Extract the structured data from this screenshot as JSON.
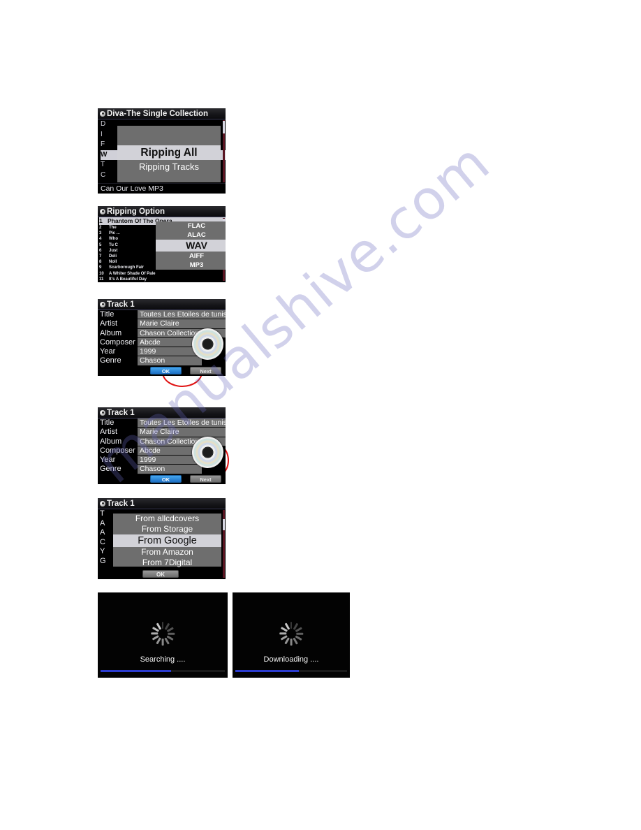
{
  "watermark": {
    "text": "manualshive.com"
  },
  "panel1": {
    "title": "Diva-The Single Collection",
    "background_rows": [
      "D",
      "I",
      "F",
      "W",
      "T",
      "C"
    ],
    "footer": "Can Our Love MP3",
    "menu": [
      {
        "label": "Ripping All",
        "selected": true
      },
      {
        "label": "Ripping Tracks",
        "selected": false
      }
    ]
  },
  "panel2": {
    "title": "Ripping Option",
    "tracks": [
      {
        "num": "1",
        "name": "Phantom Of The Opera",
        "selected": true
      },
      {
        "num": "2",
        "name": "The",
        "selected": false
      },
      {
        "num": "3",
        "name": "Pic ...",
        "selected": false
      },
      {
        "num": "4",
        "name": "Who",
        "selected": false
      },
      {
        "num": "5",
        "name": "Tu C",
        "selected": false
      },
      {
        "num": "6",
        "name": "Just",
        "selected": false
      },
      {
        "num": "7",
        "name": "Deli",
        "selected": false
      },
      {
        "num": "8",
        "name": "Noll",
        "selected": false
      },
      {
        "num": "9",
        "name": "Scarborough Fair",
        "selected": false
      },
      {
        "num": "10",
        "name": "A Whiter Shade Of Pale",
        "selected": false
      },
      {
        "num": "11",
        "name": "It's A Beautiful Day",
        "selected": false
      }
    ],
    "formats": [
      {
        "label": "FLAC",
        "selected": false
      },
      {
        "label": "ALAC",
        "selected": false
      },
      {
        "label": "WAV",
        "selected": true
      },
      {
        "label": "AIFF",
        "selected": false
      },
      {
        "label": "MP3",
        "selected": false
      }
    ]
  },
  "panel3": {
    "title": "Track 1",
    "fields": [
      {
        "label": "Title",
        "value": "Toutes Les Etoiles de tunisie"
      },
      {
        "label": "Artist",
        "value": "Marie Claire"
      },
      {
        "label": "Album",
        "value": "Chason Collection"
      },
      {
        "label": "Composer",
        "value": "Abcde"
      },
      {
        "label": "Year",
        "value": "1999"
      },
      {
        "label": "Genre",
        "value": "Chason"
      }
    ],
    "buttons": {
      "ok": "OK",
      "next": "Next"
    },
    "highlighted": "next-button"
  },
  "panel4": {
    "title": "Track 1",
    "fields": [
      {
        "label": "Title",
        "value": "Toutes Les Etoiles de tunisie"
      },
      {
        "label": "Artist",
        "value": "Marie Claire"
      },
      {
        "label": "Album",
        "value": "Chason Collection"
      },
      {
        "label": "Composer",
        "value": "Abcde"
      },
      {
        "label": "Year",
        "value": "1999"
      },
      {
        "label": "Genre",
        "value": "Chason"
      }
    ],
    "buttons": {
      "ok": "OK",
      "next": "Next"
    },
    "highlighted": "album-art"
  },
  "panel5": {
    "title": "Track 1",
    "background_rows": [
      "T",
      "A",
      "A",
      "C",
      "Y",
      "G"
    ],
    "sources": [
      {
        "label": "From allcdcovers",
        "selected": false
      },
      {
        "label": "From Storage",
        "selected": false
      },
      {
        "label": "From Google",
        "selected": true
      },
      {
        "label": "From Amazon",
        "selected": false
      },
      {
        "label": "From 7Digital",
        "selected": false
      }
    ],
    "ok_label": "OK"
  },
  "panel6": {
    "label": "Searching ....",
    "progress_percent": 57
  },
  "panel7": {
    "label": "Downloading ....",
    "progress_percent": 57
  },
  "colors": {
    "accent_blue": "#2b3ccf",
    "ok_button": "#1d6fc4",
    "highlight_red": "#e01212",
    "menu_gray": "#6e6e6e",
    "selected_row": "#d2d2d8"
  }
}
